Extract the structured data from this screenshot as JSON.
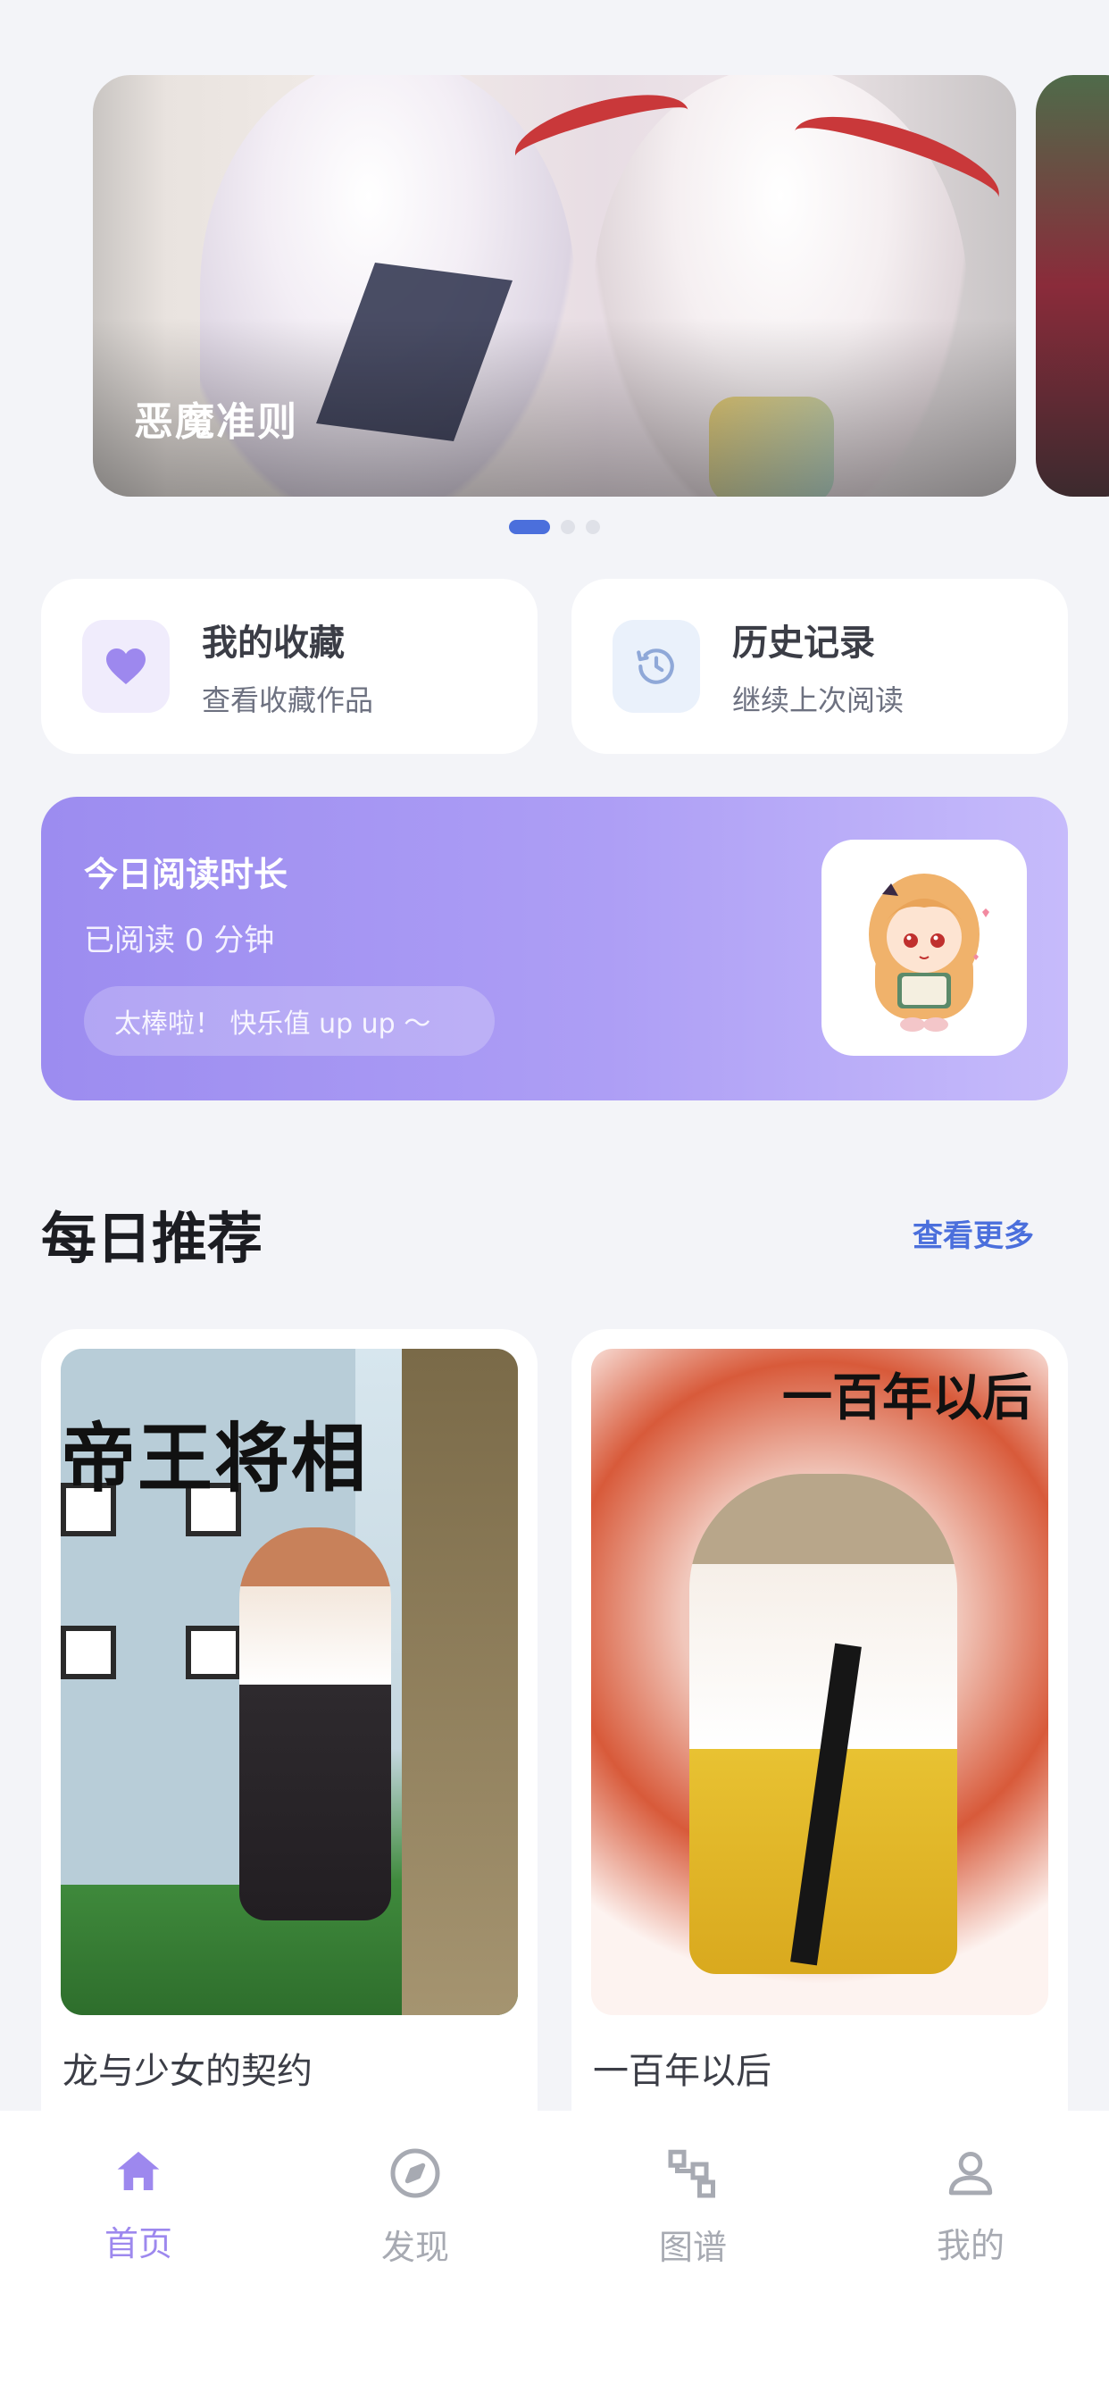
{
  "banner": {
    "title": "恶魔准则",
    "slides": 3,
    "active_index": 0
  },
  "quick_actions": [
    {
      "title": "我的收藏",
      "subtitle": "查看收藏作品",
      "icon": "heart-icon"
    },
    {
      "title": "历史记录",
      "subtitle": "继续上次阅读",
      "icon": "history-clock-icon"
    }
  ],
  "reading": {
    "title": "今日阅读时长",
    "status": "已阅读 0 分钟",
    "cheer": "太棒啦！ 快乐值 up up ～",
    "avatar_icon": "reading-girl-avatar"
  },
  "recommend": {
    "title": "每日推荐",
    "more": "查看更多",
    "books": [
      {
        "title": "龙与少女的契约",
        "cover_text": "帝王将相"
      },
      {
        "title": "一百年以后",
        "cover_text": "一百年以后"
      }
    ]
  },
  "tabbar": {
    "items": [
      {
        "label": "首页",
        "icon": "home-icon",
        "active": true
      },
      {
        "label": "发现",
        "icon": "compass-icon",
        "active": false
      },
      {
        "label": "图谱",
        "icon": "graph-icon",
        "active": false
      },
      {
        "label": "我的",
        "icon": "user-icon",
        "active": false
      }
    ]
  },
  "colors": {
    "accent": "#9d88ee",
    "link": "#4b6fdc",
    "background": "#f3f4f8"
  }
}
